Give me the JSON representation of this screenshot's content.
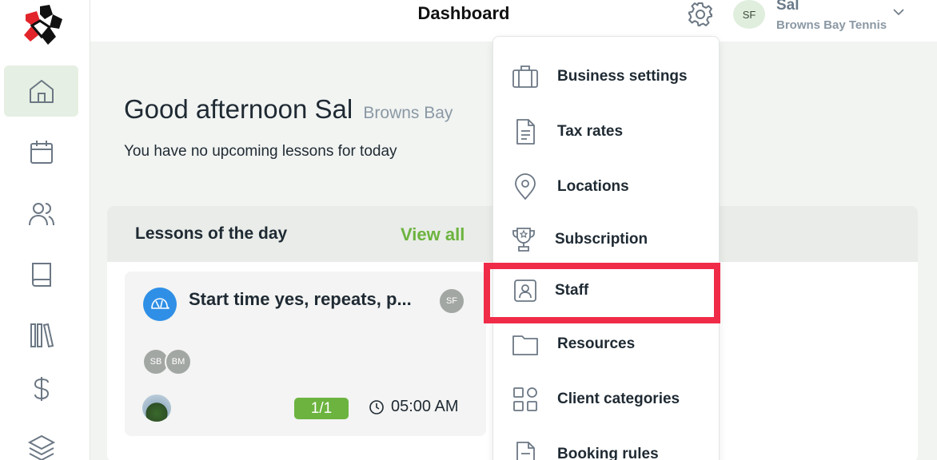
{
  "header": {
    "title": "Dashboard",
    "user": {
      "initials": "SF",
      "name": "Sal",
      "org": "Browns Bay Tennis"
    }
  },
  "sidebar": {
    "items": [
      {
        "name": "home",
        "icon": "home-icon",
        "active": true
      },
      {
        "name": "calendar",
        "icon": "calendar-icon"
      },
      {
        "name": "clients",
        "icon": "users-icon"
      },
      {
        "name": "book",
        "icon": "book-icon"
      },
      {
        "name": "library",
        "icon": "library-icon"
      },
      {
        "name": "payments",
        "icon": "dollar-icon"
      },
      {
        "name": "layers",
        "icon": "layers-icon"
      }
    ]
  },
  "main": {
    "greeting": "Good afternoon Sal",
    "greeting_org": "Browns Bay",
    "no_lessons": "You have no upcoming lessons for today",
    "lessons_title": "Lessons of the day",
    "view_all": "View all",
    "lesson": {
      "name": "Start time yes, repeats, p...",
      "coach_initials": "SF",
      "participants": [
        "SB",
        "BM"
      ],
      "capacity": "1/1",
      "time": "05:00 AM"
    }
  },
  "settings_menu": {
    "items": [
      {
        "label": "Business settings",
        "icon": "briefcase-icon"
      },
      {
        "label": "Tax rates",
        "icon": "document-icon"
      },
      {
        "label": "Locations",
        "icon": "location-pin-icon"
      },
      {
        "label": "Subscription",
        "icon": "trophy-icon"
      },
      {
        "label": "Staff",
        "icon": "staff-badge-icon",
        "highlighted": true
      },
      {
        "label": "Resources",
        "icon": "folder-icon"
      },
      {
        "label": "Client categories",
        "icon": "grid-icon"
      },
      {
        "label": "Booking rules",
        "icon": "document-rules-icon"
      }
    ]
  },
  "colors": {
    "accent_green": "#6cb33f",
    "highlight_red": "#f02b48",
    "lesson_icon_blue": "#2f8fe6"
  }
}
